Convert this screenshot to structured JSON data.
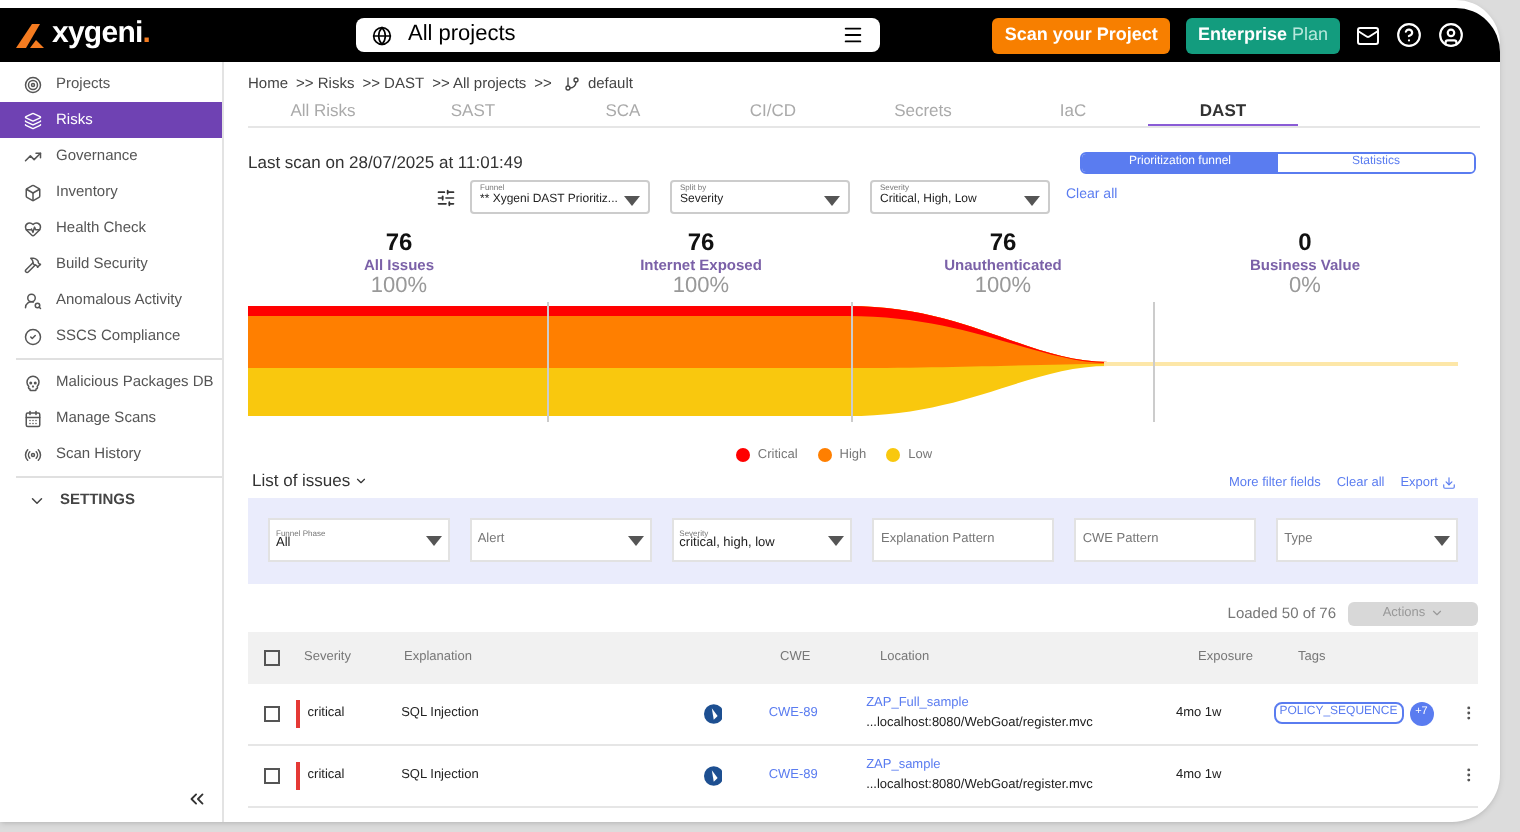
{
  "header": {
    "logo": {
      "name": "xygeni",
      "dot": "."
    },
    "project_selector": "All projects",
    "scan_button": "Scan your Project",
    "plan_button": {
      "strong": "Enterprise",
      "light": "Plan"
    }
  },
  "sidebar": {
    "items": [
      {
        "label": "Projects",
        "selected": false
      },
      {
        "label": "Risks",
        "selected": true
      },
      {
        "label": "Governance",
        "selected": false
      },
      {
        "label": "Inventory",
        "selected": false
      },
      {
        "label": "Health Check",
        "selected": false
      },
      {
        "label": "Build Security",
        "selected": false
      },
      {
        "label": "Anomalous Activity",
        "selected": false
      },
      {
        "label": "SSCS Compliance",
        "selected": false
      },
      {
        "label": "Malicious Packages DB",
        "selected": false
      },
      {
        "label": "Manage Scans",
        "selected": false
      },
      {
        "label": "Scan History",
        "selected": false
      }
    ],
    "settings": {
      "label": "SETTINGS",
      "expanded": false
    }
  },
  "breadcrumb": [
    "Home",
    ">> Risks",
    ">> DAST",
    ">> All projects",
    ">>",
    "default"
  ],
  "tabs": [
    {
      "label": "All Risks",
      "selected": false
    },
    {
      "label": "SAST",
      "selected": false
    },
    {
      "label": "SCA",
      "selected": false
    },
    {
      "label": "CI/CD",
      "selected": false
    },
    {
      "label": "Secrets",
      "selected": false
    },
    {
      "label": "IaC",
      "selected": false
    },
    {
      "label": "DAST",
      "selected": true
    }
  ],
  "last_scan": "Last scan on 28/07/2025 at 11:01:49",
  "view_toggle": [
    {
      "label": "Prioritization funnel",
      "selected": true
    },
    {
      "label": "Statistics",
      "selected": false
    }
  ],
  "funnel_controls": [
    {
      "label": "Funnel",
      "value": "** Xygeni DAST Prioritiz..."
    },
    {
      "label": "Split by",
      "value": "Severity"
    },
    {
      "label": "Severity",
      "value": "Critical, High, Low"
    }
  ],
  "clear_all": "Clear all",
  "stages": [
    {
      "count": "76",
      "label": "All Issues",
      "percent": "100%"
    },
    {
      "count": "76",
      "label": "Internet Exposed",
      "percent": "100%"
    },
    {
      "count": "76",
      "label": "Unauthenticated",
      "percent": "100%"
    },
    {
      "count": "0",
      "label": "Business Value",
      "percent": "0%"
    }
  ],
  "legend": [
    {
      "label": "Critical",
      "color": "#ff0000"
    },
    {
      "label": "High",
      "color": "#ff7f00"
    },
    {
      "label": "Low",
      "color": "#f9c80e"
    }
  ],
  "list_title": "List of issues",
  "list_links": [
    "More filter fields",
    "Clear all",
    "Export"
  ],
  "filters": [
    {
      "kind": "select",
      "label": "Funnel Phase",
      "value": "All"
    },
    {
      "kind": "select",
      "placeholder": "Alert"
    },
    {
      "kind": "select",
      "label": "Severity",
      "value": "critical, high, low"
    },
    {
      "kind": "text",
      "placeholder": "Explanation Pattern"
    },
    {
      "kind": "text",
      "placeholder": "CWE Pattern"
    },
    {
      "kind": "select",
      "placeholder": "Type"
    }
  ],
  "loaded": "Loaded 50 of 76",
  "actions": {
    "label": "Actions",
    "disabled": true
  },
  "table": {
    "select_all_checked": false,
    "columns": [
      "Severity",
      "Explanation",
      "CWE",
      "Location",
      "Exposure",
      "Tags"
    ],
    "rows": [
      {
        "checked": false,
        "severity": "critical",
        "explanation": "SQL Injection",
        "cwe": "CWE-89",
        "location_name": "ZAP_Full_sample",
        "location_path": "...localhost:8080/WebGoat/register.mvc",
        "exposure": "4mo 1w",
        "tags": [
          "POLICY_SEQUENCE"
        ],
        "more_tags": "+7"
      },
      {
        "checked": false,
        "severity": "critical",
        "explanation": "SQL Injection",
        "cwe": "CWE-89",
        "location_name": "ZAP_sample",
        "location_path": "...localhost:8080/WebGoat/register.mvc",
        "exposure": "4mo 1w",
        "tags": []
      }
    ]
  }
}
